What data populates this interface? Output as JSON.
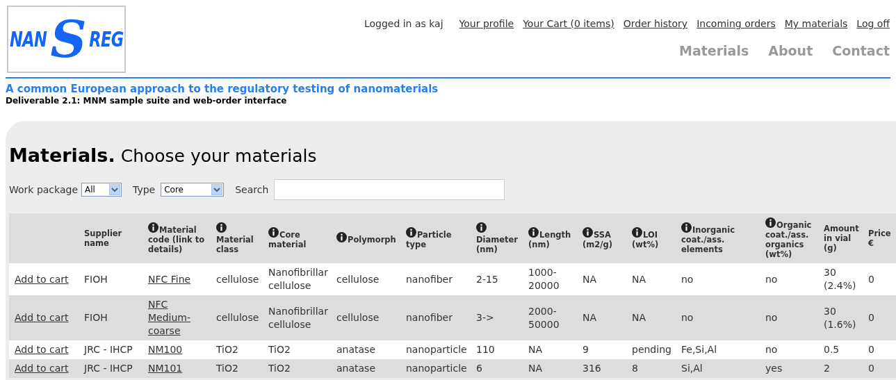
{
  "logo": {
    "left": "NAN",
    "middle": "S",
    "right": "REG"
  },
  "user_bar": {
    "status": "Logged in as kaj",
    "links": [
      "Your profile",
      "Your Cart (0 items)",
      "Order history",
      "Incoming orders",
      "My materials",
      "Log off"
    ]
  },
  "main_nav": [
    {
      "label": "Materials"
    },
    {
      "label": "About"
    },
    {
      "label": "Contact"
    }
  ],
  "tagline": "A common European approach to the regulatory testing of nanomaterials",
  "subtitle": "Deliverable 2.1: MNM sample suite and web-order interface",
  "page_title": {
    "bold": "Materials.",
    "rest": "Choose your materials"
  },
  "filters": {
    "work_package": {
      "label": "Work package",
      "value": "All"
    },
    "type": {
      "label": "Type",
      "value": "Core"
    },
    "search": {
      "label": "Search"
    }
  },
  "table": {
    "columns": [
      {
        "info": false
      },
      {
        "label": "Supplier name",
        "info": false
      },
      {
        "label": "Material code (link to details)",
        "info": true
      },
      {
        "label": "Material class",
        "info": true
      },
      {
        "label": "Core material",
        "info": true
      },
      {
        "label": "Polymorph",
        "info": true
      },
      {
        "label": "Particle type",
        "info": true
      },
      {
        "label": "Diameter (nm)",
        "info": true
      },
      {
        "label": "Length (nm)",
        "info": true
      },
      {
        "label": "SSA (m2/g)",
        "info": true
      },
      {
        "label": "LOI (wt%)",
        "info": true
      },
      {
        "label": "Inorganic coat./ass. elements",
        "info": true
      },
      {
        "label": "Organic coat./ass. organics (wt%)",
        "info": true
      },
      {
        "label": "Amount in vial (g)",
        "info": false
      },
      {
        "label": "Price €",
        "info": false
      }
    ],
    "rows": [
      {
        "cells": [
          {
            "kind": "link",
            "text": "Add to cart"
          },
          {
            "kind": "text",
            "text": "FIOH"
          },
          {
            "kind": "link",
            "text": "NFC Fine"
          },
          {
            "kind": "text",
            "text": "cellulose"
          },
          {
            "kind": "text",
            "text": "Nanofibrillar cellulose"
          },
          {
            "kind": "text",
            "text": "cellulose"
          },
          {
            "kind": "text",
            "text": "nanofiber"
          },
          {
            "kind": "text",
            "text": "2-15"
          },
          {
            "kind": "text",
            "text": "1000-20000"
          },
          {
            "kind": "text",
            "text": "NA"
          },
          {
            "kind": "text",
            "text": "NA"
          },
          {
            "kind": "text",
            "text": "no"
          },
          {
            "kind": "text",
            "text": "no"
          },
          {
            "kind": "text",
            "text": "30 (2.4%)"
          },
          {
            "kind": "text",
            "text": "0"
          }
        ]
      },
      {
        "cells": [
          {
            "kind": "link",
            "text": "Add to cart"
          },
          {
            "kind": "text",
            "text": "FIOH"
          },
          {
            "kind": "link",
            "text": "NFC Medium-coarse"
          },
          {
            "kind": "text",
            "text": "cellulose"
          },
          {
            "kind": "text",
            "text": "Nanofibrillar cellulose"
          },
          {
            "kind": "text",
            "text": "cellulose"
          },
          {
            "kind": "text",
            "text": "nanofiber"
          },
          {
            "kind": "text",
            "text": "3->"
          },
          {
            "kind": "text",
            "text": "2000-50000"
          },
          {
            "kind": "text",
            "text": "NA"
          },
          {
            "kind": "text",
            "text": "NA"
          },
          {
            "kind": "text",
            "text": "no"
          },
          {
            "kind": "text",
            "text": "no"
          },
          {
            "kind": "text",
            "text": "30 (1.6%)"
          },
          {
            "kind": "text",
            "text": "0"
          }
        ]
      },
      {
        "cells": [
          {
            "kind": "link",
            "text": "Add to cart"
          },
          {
            "kind": "text",
            "text": "JRC - IHCP"
          },
          {
            "kind": "link",
            "text": "NM100"
          },
          {
            "kind": "text",
            "text": "TiO2"
          },
          {
            "kind": "text",
            "text": "TiO2"
          },
          {
            "kind": "text",
            "text": "anatase"
          },
          {
            "kind": "text",
            "text": "nanoparticle"
          },
          {
            "kind": "text",
            "text": "110"
          },
          {
            "kind": "text",
            "text": "NA"
          },
          {
            "kind": "text",
            "text": "9"
          },
          {
            "kind": "text",
            "text": "pending"
          },
          {
            "kind": "text",
            "text": "Fe,Si,Al"
          },
          {
            "kind": "text",
            "text": "no"
          },
          {
            "kind": "text",
            "text": "0.5"
          },
          {
            "kind": "text",
            "text": "0"
          }
        ]
      },
      {
        "cells": [
          {
            "kind": "link",
            "text": "Add to cart"
          },
          {
            "kind": "text",
            "text": "JRC - IHCP"
          },
          {
            "kind": "link",
            "text": "NM101"
          },
          {
            "kind": "text",
            "text": "TiO2"
          },
          {
            "kind": "text",
            "text": "TiO2"
          },
          {
            "kind": "text",
            "text": "anatase"
          },
          {
            "kind": "text",
            "text": "nanoparticle"
          },
          {
            "kind": "text",
            "text": "6"
          },
          {
            "kind": "text",
            "text": "NA"
          },
          {
            "kind": "text",
            "text": "316"
          },
          {
            "kind": "text",
            "text": "8"
          },
          {
            "kind": "text",
            "text": "Si,Al"
          },
          {
            "kind": "text",
            "text": "yes"
          },
          {
            "kind": "text",
            "text": "2"
          },
          {
            "kind": "text",
            "text": "0"
          }
        ]
      }
    ]
  }
}
